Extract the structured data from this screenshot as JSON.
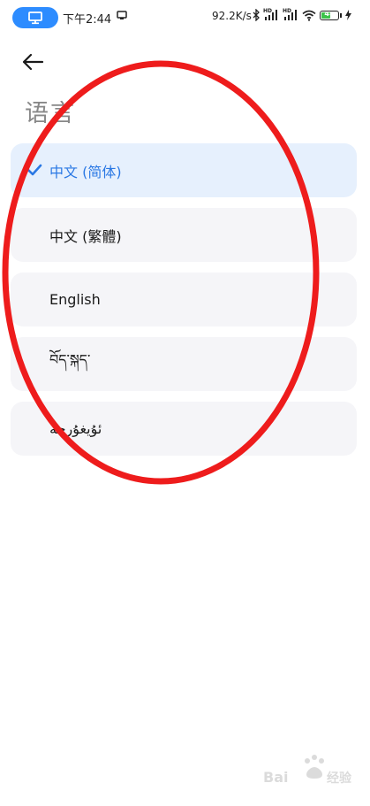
{
  "status_bar": {
    "time": "下午2:44",
    "network_speed": "92.2K/s",
    "battery_level": "48",
    "signal_tag": "HD"
  },
  "page": {
    "title": "语言"
  },
  "languages": [
    {
      "label": "中文 (简体)",
      "selected": true
    },
    {
      "label": "中文 (繁體)",
      "selected": false
    },
    {
      "label": "English",
      "selected": false
    },
    {
      "label": "བོད་སྐད་",
      "selected": false
    },
    {
      "label": "ئۇيغۇرچە",
      "selected": false
    }
  ],
  "colors": {
    "accent": "#2a78e4",
    "selected_bg": "#e6f0fd",
    "item_bg": "#f5f5f8",
    "cast_pill": "#2d8cff",
    "annotation": "#ee1c1c",
    "battery": "#3cc34a"
  },
  "icons": {
    "back": "arrow-left-icon",
    "check": "check-icon",
    "cast": "screen-cast-icon",
    "wifi": "wifi-icon",
    "bluetooth": "bluetooth-icon"
  }
}
